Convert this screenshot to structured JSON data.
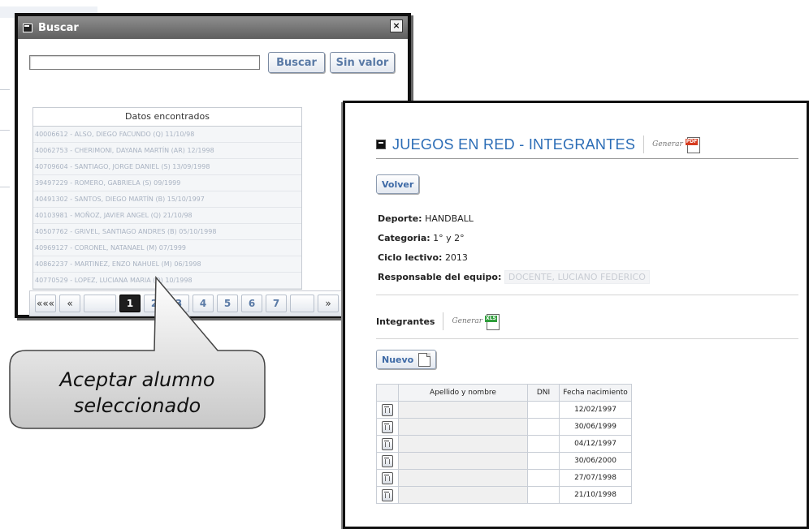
{
  "buscar_dialog": {
    "title": "Buscar",
    "close_label": "×",
    "search": {
      "value": "",
      "placeholder": ""
    },
    "buttons": {
      "buscar": "Buscar",
      "sin_valor": "Sin valor"
    },
    "results_header": "Datos encontrados",
    "results_rows": [
      "40006612 - ALSO, DIEGO FACUNDO (Q) 11/10/98",
      "40062753 - CHERIMONI, DAYANA MARTÍN (AR) 12/1998",
      "40709604 - SANTIAGO, JORGE DANIEL (S) 13/09/1998",
      "39497229 - ROMERO, GABRIELA (S) 09/1999",
      "40491302 - SANTOS, DIEGO MARTÍN (B) 15/10/1997",
      "40103981 - MOÑOZ, JAVIER ANGEL (Q) 21/10/98",
      "40507762 - GRIVEL, SANTIAGO ANDRES (B) 05/10/1998",
      "40969127 - CORONEL, NATANAEL (M) 07/1999",
      "40862237 - MARTINEZ, ENZO NAHUEL (M) 06/1998",
      "40770529 - LOPEZ, LUCIANA MARIA (Q) 10/1998"
    ],
    "pager": [
      "«««",
      "«",
      "",
      "1",
      "2",
      "3",
      "4",
      "5",
      "6",
      "7",
      "",
      "»"
    ],
    "active_page": "1"
  },
  "callout": {
    "line1": "Aceptar alumno",
    "line2": "seleccionado"
  },
  "panel": {
    "title": "JUEGOS EN RED - INTEGRANTES",
    "generar_label": "Generar",
    "pdf_icon_text": "PDF",
    "volver_label": "Volver",
    "deporte_label": "Deporte:",
    "deporte_value": "HANDBALL",
    "categoria_label": "Categoria:",
    "categoria_value": "1° y 2°",
    "ciclo_label": "Ciclo lectivo:",
    "ciclo_value": "2013",
    "responsable_label": "Responsable del equipo:",
    "responsable_value": "DOCENTE, LUCIANO FEDERICO",
    "integrantes_label": "Integrantes",
    "xls_icon_text": "XLS",
    "nuevo_label": "Nuevo",
    "table": {
      "columns": [
        "Apellido y nombre",
        "DNI",
        "Fecha nacimiento"
      ],
      "rows": [
        {
          "name": "",
          "dni": "",
          "fecha": "12/02/1997"
        },
        {
          "name": "",
          "dni": "",
          "fecha": "30/06/1999"
        },
        {
          "name": "",
          "dni": "",
          "fecha": "04/12/1997"
        },
        {
          "name": "",
          "dni": "",
          "fecha": "30/06/2000"
        },
        {
          "name": "",
          "dni": "",
          "fecha": "27/07/1998"
        },
        {
          "name": "",
          "dni": "",
          "fecha": "21/10/1998"
        }
      ]
    }
  }
}
